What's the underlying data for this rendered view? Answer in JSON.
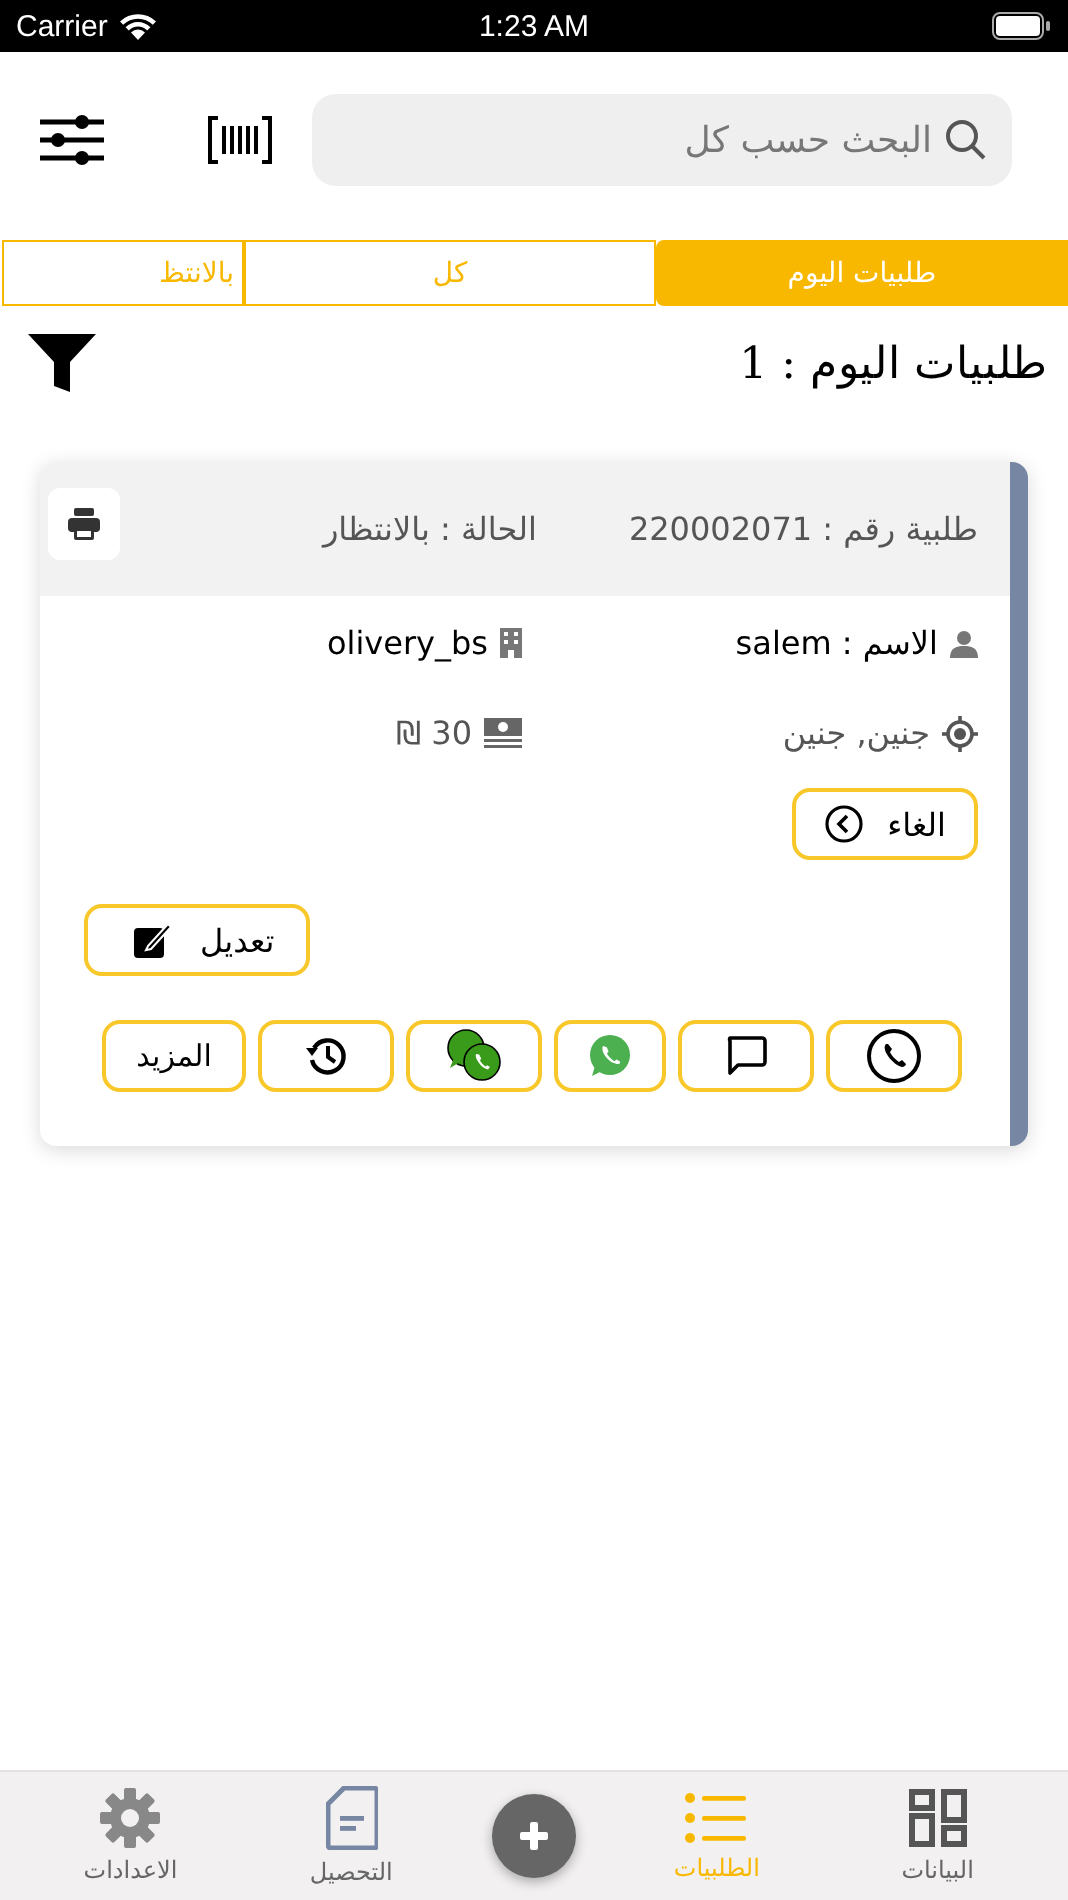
{
  "status_bar": {
    "carrier": "Carrier",
    "time": "1:23 AM"
  },
  "search": {
    "placeholder": "البحث حسب كل"
  },
  "tabs": [
    {
      "label": "طلبيات اليوم",
      "selected": true
    },
    {
      "label": "كل",
      "selected": false
    },
    {
      "label": "بالانتظ",
      "selected": false
    }
  ],
  "heading": "طلبيات اليوم : 1",
  "order": {
    "number": "طلبية رقم : 220002071",
    "status": "الحالة : بالانتظار",
    "name": "الاسم : salem",
    "company": "olivery_bs",
    "location": "جنين, جنين",
    "price": "30 ₪",
    "cancel_label": "الغاء",
    "edit_label": "تعديل",
    "actions": [
      {
        "kind": "phone"
      },
      {
        "kind": "sms"
      },
      {
        "kind": "whatsapp"
      },
      {
        "kind": "whatsapp-business"
      },
      {
        "kind": "history"
      },
      {
        "kind": "text",
        "label": "المزيد"
      }
    ]
  },
  "bottom_nav": [
    {
      "kind": "grid",
      "label": "البيانات",
      "selected": false
    },
    {
      "kind": "list",
      "label": "الطلبيات",
      "selected": true
    },
    {
      "kind": "add"
    },
    {
      "kind": "document",
      "label": "التحصيل",
      "selected": false
    },
    {
      "kind": "gear",
      "label": "الاعدادات",
      "selected": false
    }
  ]
}
